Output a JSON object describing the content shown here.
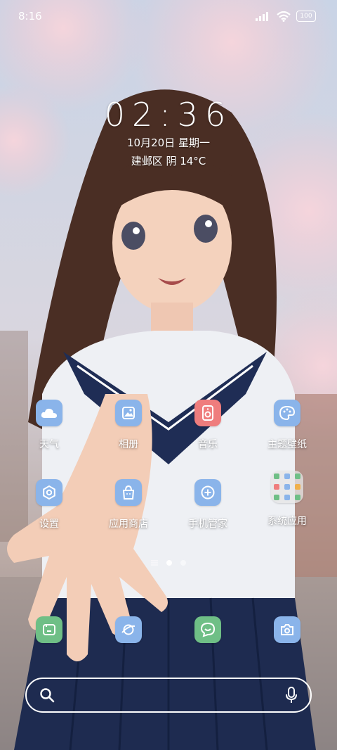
{
  "status_bar": {
    "time": "8:16",
    "battery": "100"
  },
  "lock": {
    "clock": "02:36",
    "date": "10月20日 星期一",
    "weather": "建邺区 阴 14°C"
  },
  "apps": [
    {
      "label": "天气",
      "icon": "cloud-icon",
      "color": "#8ab4ea"
    },
    {
      "label": "相册",
      "icon": "gallery-icon",
      "color": "#8ab4ea"
    },
    {
      "label": "音乐",
      "icon": "music-speaker-icon",
      "color": "#ef7d7d"
    },
    {
      "label": "主题壁纸",
      "icon": "palette-icon",
      "color": "#8ab4ea"
    },
    {
      "label": "设置",
      "icon": "gear-icon",
      "color": "#8ab4ea"
    },
    {
      "label": "应用商店",
      "icon": "shopping-bag-icon",
      "color": "#8ab4ea"
    },
    {
      "label": "手机管家",
      "icon": "plus-circle-icon",
      "color": "#8ab4ea"
    },
    {
      "label": "系统应用",
      "icon": "folder-icon",
      "color": "#e6e6e6"
    }
  ],
  "dock": [
    {
      "icon": "messages-icon",
      "color": "#6fbf86"
    },
    {
      "icon": "browser-planet-icon",
      "color": "#8ab4ea"
    },
    {
      "icon": "chat-face-icon",
      "color": "#6fbf86"
    },
    {
      "icon": "camera-icon",
      "color": "#8ab4ea"
    }
  ],
  "search": {
    "placeholder": ""
  }
}
